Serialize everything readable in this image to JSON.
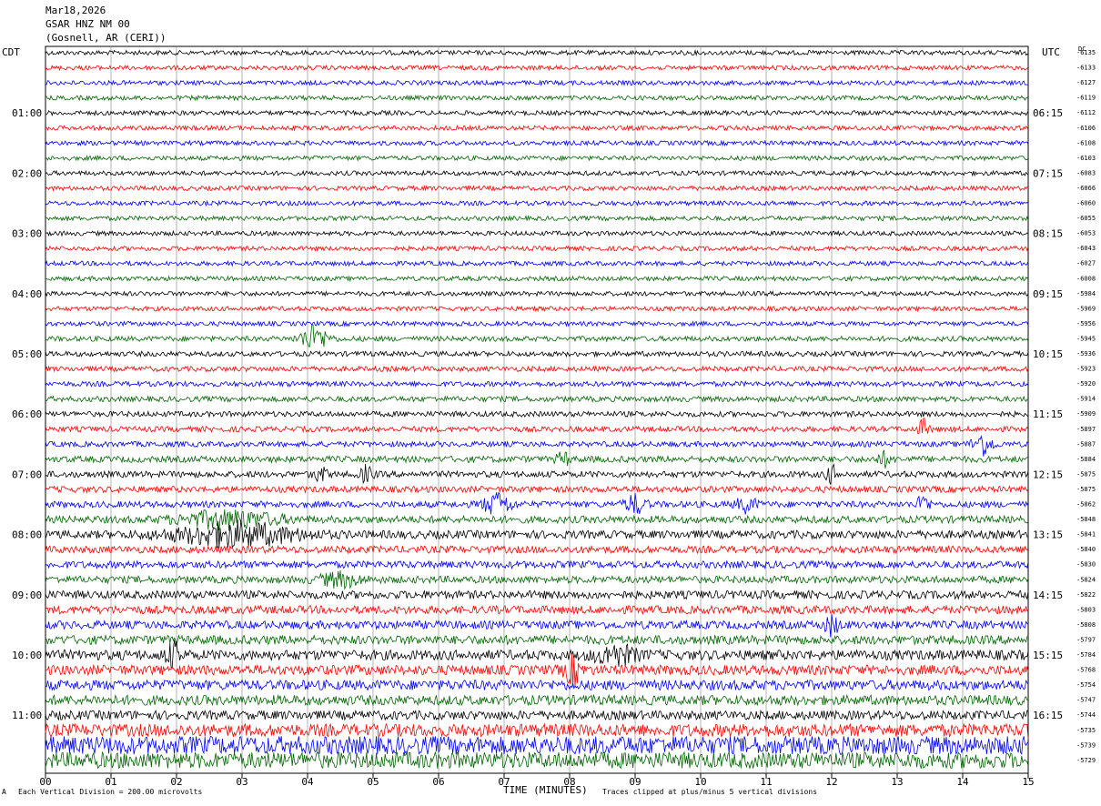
{
  "header": {
    "date": "Mar18,2026",
    "station": "GSAR HNZ NM 00",
    "location": "(Gosnell, AR (CERI))"
  },
  "left_zone": "CDT",
  "right_zone": "UTC",
  "dc_label": "DC",
  "footer": {
    "scale_note": "Each Vertical Division =  200.00 microvolts",
    "clip_note": "Traces clipped at plus/minus 5 vertical divisions",
    "corner_mark": "A"
  },
  "colors": {
    "cycle": [
      "#000000",
      "#ff0000",
      "#0000ff",
      "#006400"
    ],
    "grid": "#808080"
  },
  "chart_data": {
    "type": "line",
    "xlabel": "TIME (MINUTES)",
    "x_ticks": [
      "00",
      "01",
      "02",
      "03",
      "04",
      "05",
      "06",
      "07",
      "08",
      "09",
      "10",
      "11",
      "12",
      "13",
      "14",
      "15"
    ],
    "xlim": [
      0,
      15
    ],
    "left_hour_labels": [
      "01:00",
      "02:00",
      "03:00",
      "04:00",
      "05:00",
      "06:00",
      "07:00",
      "08:00",
      "09:00",
      "10:00",
      "11:00"
    ],
    "right_hour_labels": [
      "06:15",
      "07:15",
      "08:15",
      "09:15",
      "10:15",
      "11:15",
      "12:15",
      "13:15",
      "14:15",
      "15:15",
      "16:15"
    ],
    "dc_offsets": [
      "-6135",
      "-6133",
      "-6127",
      "-6119",
      "-6112",
      "-6106",
      "-6108",
      "-6103",
      "-6083",
      "-6066",
      "-6060",
      "-6055",
      "-6053",
      "-6043",
      "-6027",
      "-6008",
      "-5984",
      "-5969",
      "-5956",
      "-5945",
      "-5936",
      "-5923",
      "-5920",
      "-5914",
      "-5909",
      "-5897",
      "-5887",
      "-5884",
      "-5875",
      "-5875",
      "-5862",
      "-5848",
      "-5841",
      "-5840",
      "-5830",
      "-5824",
      "-5822",
      "-5803",
      "-5808",
      "-5797",
      "-5784",
      "-5768",
      "-5754",
      "-5747",
      "-5744",
      "-5735",
      "-5739",
      "-5729"
    ],
    "noise_levels": [
      2.5,
      2.5,
      2.5,
      2.5,
      2.5,
      2.5,
      2.5,
      2.5,
      2.5,
      2.5,
      2.5,
      2.5,
      2.5,
      2.5,
      2.5,
      2.5,
      2.5,
      2.5,
      2.5,
      2.8,
      2.8,
      2.8,
      2.8,
      3,
      3,
      3,
      3,
      3.5,
      3.5,
      3.5,
      3.5,
      4,
      4.5,
      4,
      4,
      4,
      4.5,
      4.5,
      4.5,
      5,
      5.5,
      5.5,
      5.5,
      5.5,
      5,
      7,
      10,
      9
    ],
    "events": [
      {
        "trace": 19,
        "minute": 4.1,
        "amp": 14,
        "width": 0.2
      },
      {
        "trace": 25,
        "minute": 13.4,
        "amp": 10,
        "width": 0.08
      },
      {
        "trace": 26,
        "minute": 14.3,
        "amp": 12,
        "width": 0.15
      },
      {
        "trace": 27,
        "minute": 7.9,
        "amp": 7,
        "width": 0.1
      },
      {
        "trace": 27,
        "minute": 12.8,
        "amp": 7,
        "width": 0.1
      },
      {
        "trace": 28,
        "minute": 4.2,
        "amp": 7,
        "width": 0.1
      },
      {
        "trace": 28,
        "minute": 4.9,
        "amp": 8,
        "width": 0.1
      },
      {
        "trace": 28,
        "minute": 12.0,
        "amp": 9,
        "width": 0.08
      },
      {
        "trace": 30,
        "minute": 6.9,
        "amp": 12,
        "width": 0.2
      },
      {
        "trace": 30,
        "minute": 9.0,
        "amp": 10,
        "width": 0.15
      },
      {
        "trace": 30,
        "minute": 10.7,
        "amp": 8,
        "width": 0.15
      },
      {
        "trace": 30,
        "minute": 13.4,
        "amp": 12,
        "width": 0.08
      },
      {
        "trace": 31,
        "minute": 2.8,
        "amp": 9,
        "width": 0.7
      },
      {
        "trace": 32,
        "minute": 2.9,
        "amp": 12,
        "width": 0.9
      },
      {
        "trace": 35,
        "minute": 4.5,
        "amp": 7,
        "width": 0.3
      },
      {
        "trace": 38,
        "minute": 12.0,
        "amp": 10,
        "width": 0.1
      },
      {
        "trace": 40,
        "minute": 1.95,
        "amp": 12,
        "width": 0.12
      },
      {
        "trace": 40,
        "minute": 8.7,
        "amp": 10,
        "width": 0.3
      },
      {
        "trace": 41,
        "minute": 8.05,
        "amp": 14,
        "width": 0.12
      },
      {
        "trace": 45,
        "minute": 15.0,
        "amp": 9,
        "width": 0.05
      }
    ]
  }
}
